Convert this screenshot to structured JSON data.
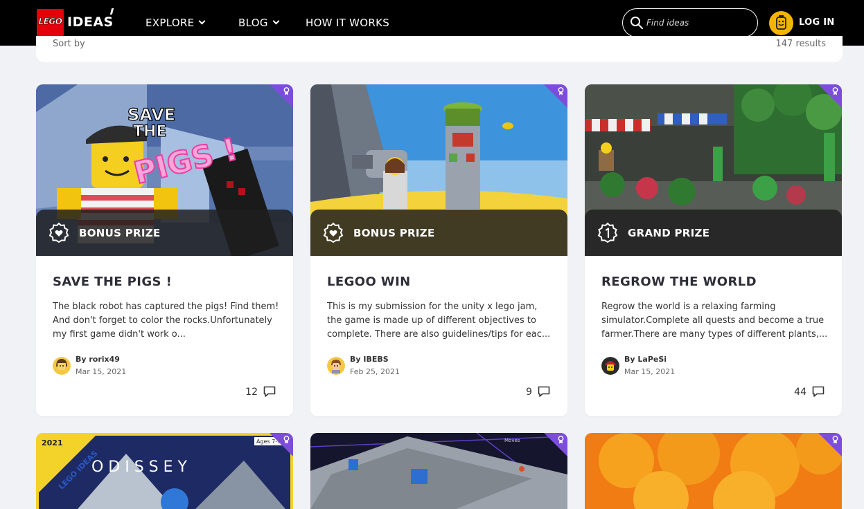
{
  "header": {
    "logo_lego": "LEGO",
    "logo_ideas": "IDEAS",
    "nav": [
      {
        "label": "EXPLORE"
      },
      {
        "label": "BLOG"
      },
      {
        "label": "HOW IT WORKS"
      }
    ],
    "search_placeholder": "Find ideas",
    "login_label": "LOG IN"
  },
  "toolbar": {
    "sort_label": "Sort by",
    "results_label": "147 results"
  },
  "cards": [
    {
      "prize": "BONUS PRIZE",
      "title": "SAVE THE PIGS !",
      "description": "The black robot has captured the pigs! Find them! And don't forget to color the rocks.Unfortunately my first game didn't work o...",
      "author": "By rorix49",
      "date": "Mar 15, 2021",
      "comments": "12",
      "thumb_text_1": "SAVE",
      "thumb_text_2": "THE",
      "thumb_text_3": "PIGS !"
    },
    {
      "prize": "BONUS PRIZE",
      "title": "LEGOO WIN",
      "description": "This is my submission for the unity x lego jam, the game is made up of  different objectives to complete. There are also guidelines/tips for eac...",
      "author": "By IBEBS",
      "date": "Feb 25, 2021",
      "comments": "9"
    },
    {
      "prize": "GRAND PRIZE",
      "title": "REGROW THE WORLD",
      "description": "Regrow the world is a relaxing farming simulator.Complete all quests and become a true farmer.There are many types of different plants,...",
      "author": "By LaPeSi",
      "date": "Mar 15, 2021",
      "comments": "44"
    }
  ],
  "second_row": {
    "card1_year": "2021",
    "card1_badge": "LEGO IDEAS",
    "card1_ages": "Ages 7-99",
    "card1_title": "O D I S S E Y",
    "card2_label": "Moves"
  },
  "colors": {
    "brand_red": "#e3000b",
    "accent_purple": "#7c4ddb",
    "login_yellow": "#f4b400"
  }
}
